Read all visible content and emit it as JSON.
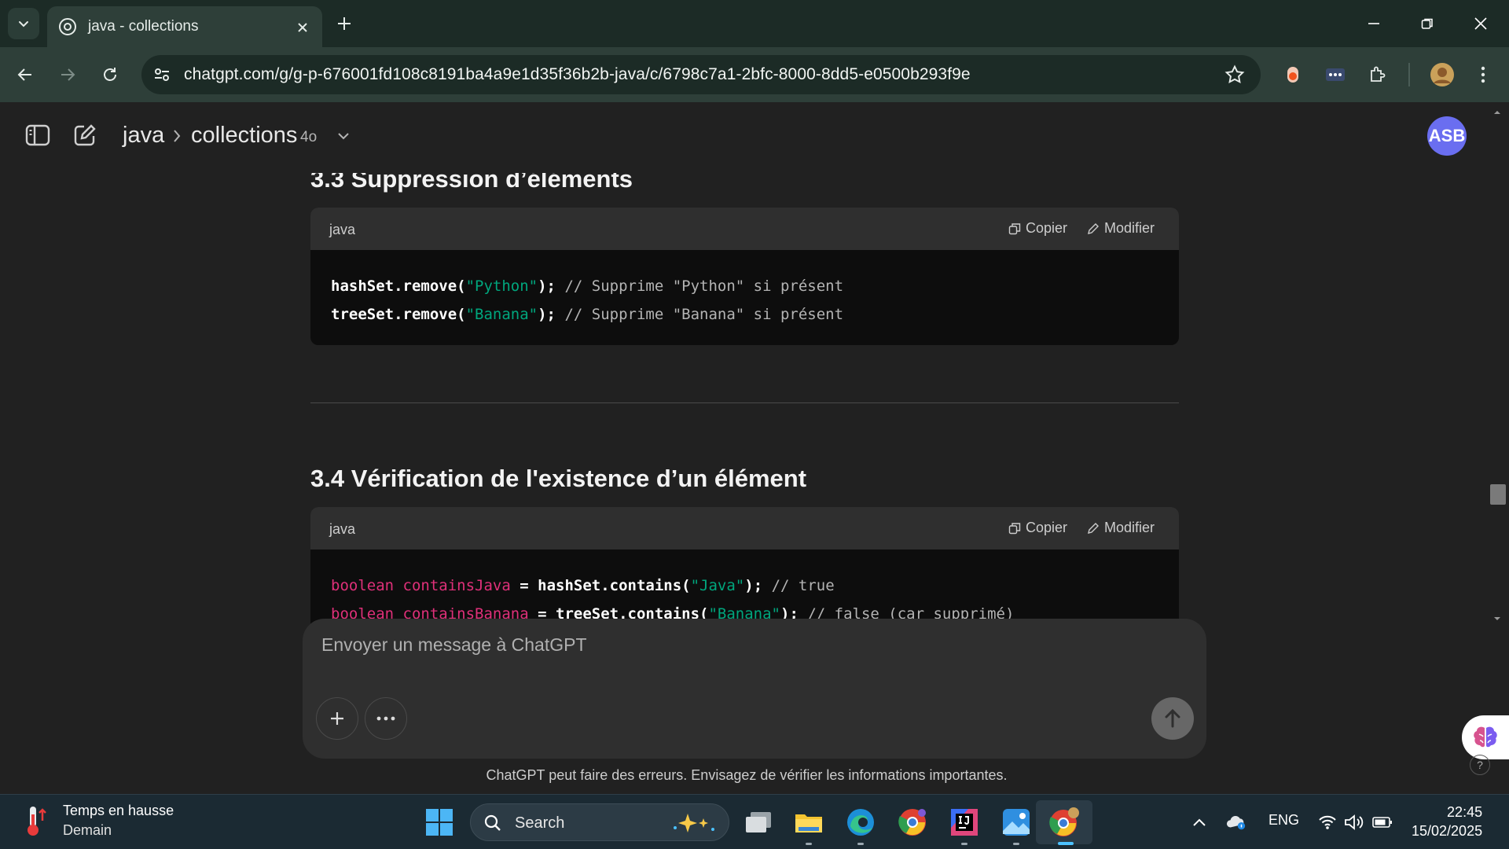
{
  "browser": {
    "tab_title": "java - collections",
    "url": "chatgpt.com/g/g-p-676001fd108c8191ba4a9e1d35f36b2b-java/c/6798c7a1-2bfc-8000-8dd5-e0500b293f9e"
  },
  "header": {
    "project": "java",
    "conversation": "collections",
    "model": "4o",
    "avatar_initials": "ASB"
  },
  "sections": [
    {
      "title": "3.3 Suppression d’éléments",
      "code_lang": "java",
      "copy_label": "Copier",
      "edit_label": "Modifier"
    },
    {
      "title": "3.4 Vérification de l'existence d’un élément",
      "code_lang": "java",
      "copy_label": "Copier",
      "edit_label": "Modifier"
    }
  ],
  "code": {
    "s1": {
      "l1": {
        "a": "hashSet.remove(",
        "b": "\"Python\"",
        "c": "); ",
        "d": "// Supprime \"Python\" si présent"
      },
      "l2": {
        "a": "treeSet.remove(",
        "b": "\"Banana\"",
        "c": "); ",
        "d": "// Supprime \"Banana\" si présent"
      }
    },
    "s2": {
      "l1": {
        "kw": "boolean",
        "var": "containsJava",
        "eq": " = ",
        "a": "hashSet.contains(",
        "b": "\"Java\"",
        "c": "); ",
        "d": "// true"
      },
      "l2": {
        "kw": "boolean",
        "var": "containsBanana",
        "eq": " = ",
        "a": "treeSet.contains(",
        "b": "\"Banana\"",
        "c": "); ",
        "d": "// false (car supprimé)"
      }
    }
  },
  "composer": {
    "placeholder": "Envoyer un message à ChatGPT"
  },
  "disclaimer": "ChatGPT peut faire des erreurs. Envisagez de vérifier les informations importantes.",
  "taskbar": {
    "weather_title": "Temps en hausse",
    "weather_sub": "Demain",
    "search_label": "Search",
    "lang": "ENG",
    "time": "22:45",
    "date": "15/02/2025"
  },
  "colors": {
    "accent_avatar": "#6a6ef0",
    "code_string": "#00a67d",
    "code_keyword": "#f22c3d",
    "taskbar_active": "#4cc2ff"
  }
}
